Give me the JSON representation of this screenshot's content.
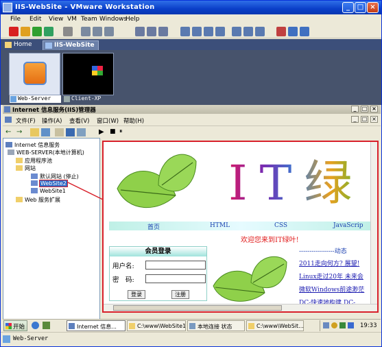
{
  "window": {
    "title": "IIS-WebSite - VMware Workstation",
    "min": "_",
    "max": "□",
    "close": "×"
  },
  "menu": [
    "File",
    "Edit",
    "View",
    "VM",
    "Team",
    "Windows",
    "Help"
  ],
  "tabs": [
    {
      "label": "Home",
      "close": ""
    },
    {
      "label": "IIS-WebSite",
      "close": "×"
    }
  ],
  "thumbnails": [
    {
      "label": "Web-Server",
      "selected": true
    },
    {
      "label": "Client-XP",
      "selected": false
    }
  ],
  "mmc": {
    "title": "Internet 信息服务(IIS)管理器",
    "controls": [
      "_",
      "□",
      "×"
    ],
    "inner_controls": [
      "_",
      "□",
      "×"
    ],
    "menu": [
      "文件(F)",
      "操作(A)",
      "查看(V)",
      "窗口(W)",
      "帮助(H)"
    ],
    "toolbar_glyphs": [
      "←",
      "→",
      "▶",
      "■",
      "⏸"
    ]
  },
  "tree": [
    {
      "label": "Internet 信息服务",
      "level": 0
    },
    {
      "label": "WEB-SERVER(本地计算机)",
      "level": 1
    },
    {
      "label": "应用程序池",
      "level": 2
    },
    {
      "label": "网站",
      "level": 2
    },
    {
      "label": "默认网站 (停止)",
      "level": 3
    },
    {
      "label": "WebSite2",
      "level": 3,
      "selected": true
    },
    {
      "label": "WebSite1",
      "level": 3
    },
    {
      "label": "Web 服务扩展",
      "level": 2
    }
  ],
  "site": {
    "logo_text": "IT绿",
    "nav": [
      "首页",
      "HTML",
      "CSS",
      "JavaScrip"
    ],
    "welcome": "欢迎您来到IT绿叶!",
    "login": {
      "title": "会员登录",
      "user_label": "用户名:",
      "pass_label": "密　码:",
      "login_btn": "登录",
      "register_btn": "注册"
    },
    "news_head": "-----------------动态",
    "news": [
      "2011走向何方? 展望!",
      "Linux走过20年 未来会",
      "微软Windows前途渺茫",
      "DC-快速地构建 DC-"
    ]
  },
  "taskbar": {
    "start": "开始",
    "tasks": [
      "Internet 信息...",
      "C:\\www\\WebSite1",
      "本地连接 状态",
      "C:\\www\\WebSit..."
    ],
    "clock": "19:33"
  },
  "status": "Web-Server",
  "colors": {
    "accent_red": "#d8202a",
    "title_blue": "#0a3fc8",
    "link_blue": "#1a3fb0"
  }
}
